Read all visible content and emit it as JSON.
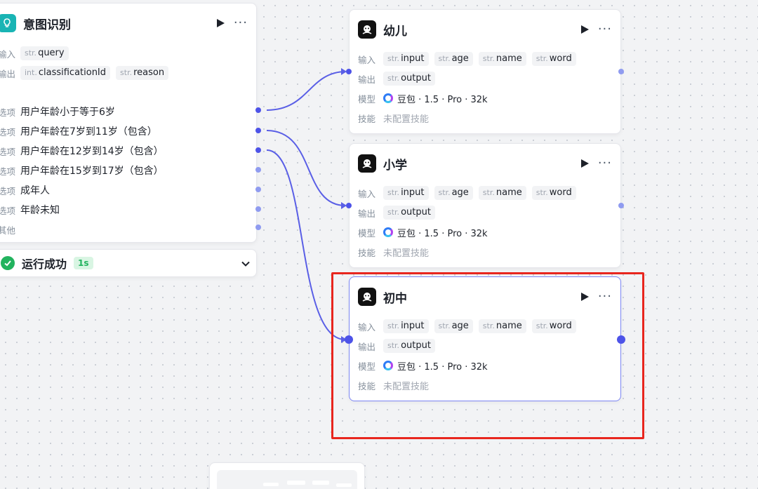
{
  "intent_node": {
    "title": "意图识别",
    "input_label": "输入",
    "output_label": "输出",
    "inputs": [
      {
        "type": "str.",
        "name": "query"
      }
    ],
    "outputs": [
      {
        "type": "int.",
        "name": "classificationId"
      },
      {
        "type": "str.",
        "name": "reason"
      }
    ],
    "option_label": "选项",
    "options": [
      "用户年龄小于等于6岁",
      "用户年龄在7岁到11岁（包含）",
      "用户年龄在12岁到14岁（包含）",
      "用户年龄在15岁到17岁（包含）",
      "成年人",
      "年龄未知"
    ],
    "other_label": "其他"
  },
  "run_status": {
    "text": "运行成功",
    "duration": "1s",
    "color": "#22b35e"
  },
  "llm_nodes": [
    {
      "title": "幼儿",
      "input_label": "输入",
      "output_label": "输出",
      "model_label": "模型",
      "skill_label": "技能",
      "inputs": [
        {
          "type": "str.",
          "name": "input"
        },
        {
          "type": "str.",
          "name": "age"
        },
        {
          "type": "str.",
          "name": "name"
        },
        {
          "type": "str.",
          "name": "word"
        }
      ],
      "outputs": [
        {
          "type": "str.",
          "name": "output"
        }
      ],
      "model": "豆包 · 1.5 · Pro · 32k",
      "skill": "未配置技能"
    },
    {
      "title": "小学",
      "input_label": "输入",
      "output_label": "输出",
      "model_label": "模型",
      "skill_label": "技能",
      "inputs": [
        {
          "type": "str.",
          "name": "input"
        },
        {
          "type": "str.",
          "name": "age"
        },
        {
          "type": "str.",
          "name": "name"
        },
        {
          "type": "str.",
          "name": "word"
        }
      ],
      "outputs": [
        {
          "type": "str.",
          "name": "output"
        }
      ],
      "model": "豆包 · 1.5 · Pro · 32k",
      "skill": "未配置技能"
    },
    {
      "title": "初中",
      "input_label": "输入",
      "output_label": "输出",
      "model_label": "模型",
      "skill_label": "技能",
      "inputs": [
        {
          "type": "str.",
          "name": "input"
        },
        {
          "type": "str.",
          "name": "age"
        },
        {
          "type": "str.",
          "name": "name"
        },
        {
          "type": "str.",
          "name": "word"
        }
      ],
      "outputs": [
        {
          "type": "str.",
          "name": "output"
        }
      ],
      "model": "豆包 · 1.5 · Pro · 32k",
      "skill": "未配置技能"
    }
  ],
  "colors": {
    "edge": "#5a5fe6",
    "port": "#4d53e8",
    "highlight": "#e8261e",
    "intent_icon": "#19b4b4"
  },
  "icons": {
    "intent": "lightbulb-icon",
    "llm": "llm-bot-icon",
    "run": "play-icon",
    "more": "more-icon",
    "status": "check-circle-icon",
    "expand": "chevron-down-icon"
  }
}
